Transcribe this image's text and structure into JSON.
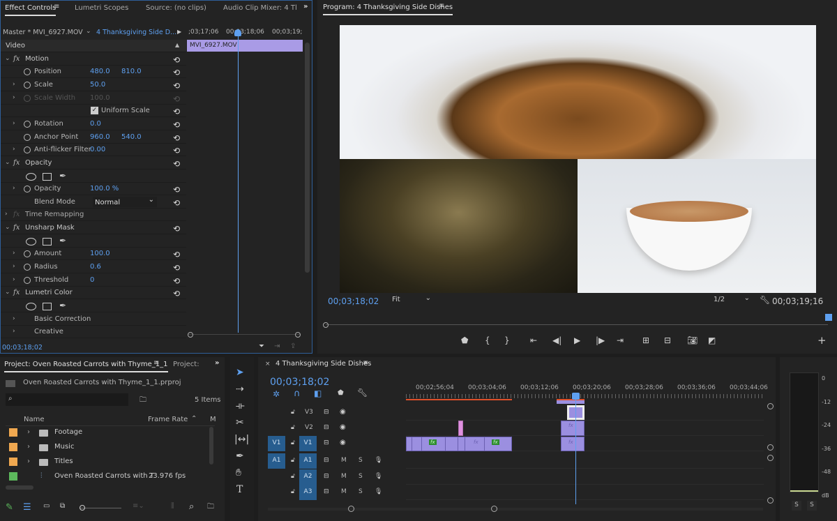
{
  "effect_controls": {
    "tabs": [
      "Effect Controls",
      "Lumetri Scopes",
      "Source: (no clips)",
      "Audio Clip Mixer: 4 Tl"
    ],
    "master": "Master * MVI_6927.MOV",
    "sequence": "4 Thanksgiving Side D...",
    "ruler": [
      ";03;17;06",
      "00;03;18;06",
      "00;03;19;"
    ],
    "clip_name": "MVI_6927.MOV",
    "timecode": "00;03;18;02",
    "rows": [
      {
        "kind": "header",
        "label": "Video"
      },
      {
        "kind": "fx",
        "label": "Motion",
        "reset": true
      },
      {
        "kind": "prop",
        "label": "Position",
        "v1": "480.0",
        "v2": "810.0",
        "twirl": false,
        "reset": true
      },
      {
        "kind": "prop",
        "label": "Scale",
        "v1": "50.0",
        "twirl": true,
        "reset": true
      },
      {
        "kind": "prop",
        "label": "Scale Width",
        "v1": "100.0",
        "twirl": true,
        "disabled": true,
        "reset": true
      },
      {
        "kind": "check",
        "label": "Uniform Scale",
        "checked": true,
        "reset": true
      },
      {
        "kind": "prop",
        "label": "Rotation",
        "v1": "0.0",
        "twirl": true,
        "reset": true
      },
      {
        "kind": "prop",
        "label": "Anchor Point",
        "v1": "960.0",
        "v2": "540.0",
        "twirl": false,
        "reset": true
      },
      {
        "kind": "prop",
        "label": "Anti-flicker Filter",
        "v1": "0.00",
        "twirl": true,
        "reset": true
      },
      {
        "kind": "fx",
        "label": "Opacity",
        "reset": true
      },
      {
        "kind": "masks"
      },
      {
        "kind": "prop",
        "label": "Opacity",
        "v1": "100.0 %",
        "twirl": true,
        "reset": true
      },
      {
        "kind": "select",
        "label": "Blend Mode",
        "value": "Normal",
        "reset": true
      },
      {
        "kind": "fx",
        "label": "Time Remapping",
        "disabled": true,
        "collapsed": true
      },
      {
        "kind": "fx",
        "label": "Unsharp Mask",
        "reset": true
      },
      {
        "kind": "masks"
      },
      {
        "kind": "prop",
        "label": "Amount",
        "v1": "100.0",
        "twirl": true,
        "reset": true
      },
      {
        "kind": "prop",
        "label": "Radius",
        "v1": "0.6",
        "twirl": true,
        "reset": true
      },
      {
        "kind": "prop",
        "label": "Threshold",
        "v1": "0",
        "twirl": true,
        "reset": true
      },
      {
        "kind": "fx",
        "label": "Lumetri Color",
        "reset": true
      },
      {
        "kind": "masks"
      },
      {
        "kind": "group",
        "label": "Basic Correction"
      },
      {
        "kind": "group",
        "label": "Creative"
      }
    ]
  },
  "program": {
    "title": "Program: 4 Thanksgiving Side Dishes",
    "timecode": "00;03;18;02",
    "fit": "Fit",
    "resolution": "1/2",
    "duration": "00;03;19;16"
  },
  "project": {
    "tabs": [
      "Project: Oven Roasted Carrots with Thyme_1_1",
      "Project: "
    ],
    "file": "Oven Roasted Carrots with Thyme_1_1.prproj",
    "search_placeholder": "",
    "items_count": "5 Items",
    "columns": [
      "Name",
      "Frame Rate",
      "M"
    ],
    "items": [
      {
        "name": "Footage",
        "type": "folder",
        "color": "#f0a850",
        "frame_rate": ""
      },
      {
        "name": "Music",
        "type": "folder",
        "color": "#f0a850",
        "frame_rate": ""
      },
      {
        "name": "Titles",
        "type": "folder",
        "color": "#f0a850",
        "frame_rate": ""
      },
      {
        "name": "Oven Roasted Carrots with T",
        "type": "sequence",
        "color": "#5cb85c",
        "frame_rate": "23.976 fps"
      }
    ]
  },
  "timeline": {
    "title": "4 Thanksgiving Side Dishes",
    "timecode": "00;03;18;02",
    "ruler": [
      "00;02;56;04",
      "00;03;04;06",
      "00;03;12;06",
      "00;03;20;06",
      "00;03;28;06",
      "00;03;36;06",
      "00;03;44;06"
    ],
    "video_tracks": [
      {
        "src": "",
        "name": "V3"
      },
      {
        "src": "",
        "name": "V2"
      },
      {
        "src": "V1",
        "name": "V1"
      }
    ],
    "audio_tracks": [
      {
        "src": "A1",
        "name": "A1"
      },
      {
        "src": "",
        "name": "A2"
      },
      {
        "src": "",
        "name": "A3"
      }
    ],
    "mute": "M",
    "solo": "S",
    "fx": "fx"
  },
  "meter": {
    "scale": [
      "0",
      "-12",
      "-24",
      "-36",
      "-48",
      "dB"
    ],
    "solo": [
      "S",
      "S"
    ]
  },
  "colors": {
    "accent": "#5ea0f0",
    "clip": "#9b8fe0",
    "track_target": "#275d8f",
    "work_area": "#e0502a"
  }
}
